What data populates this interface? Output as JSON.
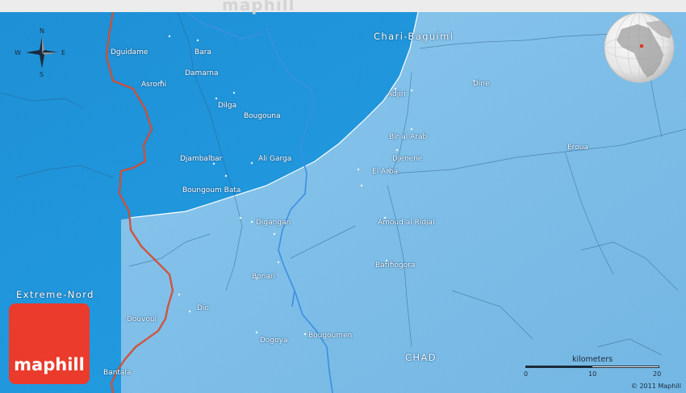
{
  "map": {
    "watermark": "maphill",
    "logo_text": "maphill",
    "copyright": "© 2011 Maphill",
    "compass": {
      "n": "N",
      "s": "S",
      "e": "E",
      "w": "W"
    },
    "scale": {
      "title": "kilometers",
      "ticks": [
        "0",
        "10",
        "20"
      ]
    },
    "regions": {
      "chari_baguimi": "Chari-Baguimi",
      "extreme_nord": "Extreme-Nord",
      "chad": "CHAD"
    },
    "places": [
      {
        "id": "dguidame",
        "name": "Dguidame"
      },
      {
        "id": "bara",
        "name": "Bara"
      },
      {
        "id": "damarna",
        "name": "Damarna"
      },
      {
        "id": "asromi",
        "name": "Asromi"
      },
      {
        "id": "dilga",
        "name": "Dilga"
      },
      {
        "id": "bougouna",
        "name": "Bougouna"
      },
      {
        "id": "djambalbar",
        "name": "Djambalbar"
      },
      {
        "id": "ali-garga",
        "name": "Ali Garga"
      },
      {
        "id": "boungoum-bata",
        "name": "Boungoum  Bata"
      },
      {
        "id": "digangan",
        "name": "Digangan"
      },
      {
        "id": "bonari",
        "name": "Bonari"
      },
      {
        "id": "dio",
        "name": "Dio"
      },
      {
        "id": "douvoul",
        "name": "Douvoul"
      },
      {
        "id": "dogoya",
        "name": "Dogoya"
      },
      {
        "id": "bougoumen",
        "name": "Bougoumen"
      },
      {
        "id": "bantala",
        "name": "Bantala"
      },
      {
        "id": "adjiri",
        "name": "Adjiri"
      },
      {
        "id": "dine",
        "name": "Dine"
      },
      {
        "id": "bir-al-arab",
        "name": "Bir al Arab"
      },
      {
        "id": "djenene",
        "name": "Djenene"
      },
      {
        "id": "el-arba",
        "name": "El Arba"
      },
      {
        "id": "eroua",
        "name": "Eroua"
      },
      {
        "id": "amoud-al-ridjal",
        "name": "Amoud al Ridjal"
      },
      {
        "id": "batifiogora",
        "name": "Batifiogora"
      }
    ],
    "colors": {
      "outer_region": "#1a95de",
      "focus_region": "#7cc0ea",
      "border": "#d0402a",
      "river": "#3a8ee0",
      "logo": "#ea3b2c"
    }
  }
}
